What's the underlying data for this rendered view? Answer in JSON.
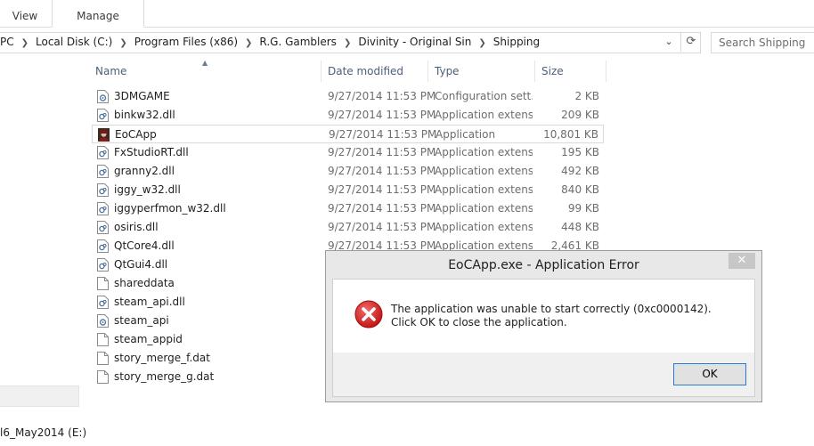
{
  "ribbon": {
    "tabs": [
      {
        "label": "View"
      },
      {
        "label": "Manage"
      }
    ]
  },
  "address": {
    "crumbs": [
      "PC",
      "Local Disk (C:)",
      "Program Files (x86)",
      "R.G. Gamblers",
      "Divinity - Original Sin",
      "Shipping"
    ],
    "search_placeholder": "Search Shipping"
  },
  "nav": {
    "drive_label": "l6_May2014 (E:)"
  },
  "columns": {
    "name": "Name",
    "date": "Date modified",
    "type": "Type",
    "size": "Size"
  },
  "files": [
    {
      "name": "3DMGAME",
      "date": "9/27/2014 11:53 PM",
      "type": "Configuration sett...",
      "size": "2 KB",
      "icon": "config-file-icon"
    },
    {
      "name": "binkw32.dll",
      "date": "9/27/2014 11:53 PM",
      "type": "Application extens...",
      "size": "209 KB",
      "icon": "dll-file-icon"
    },
    {
      "name": "EoCApp",
      "date": "9/27/2014 11:53 PM",
      "type": "Application",
      "size": "10,801 KB",
      "icon": "app-icon"
    },
    {
      "name": "FxStudioRT.dll",
      "date": "9/27/2014 11:53 PM",
      "type": "Application extens...",
      "size": "195 KB",
      "icon": "dll-file-icon"
    },
    {
      "name": "granny2.dll",
      "date": "9/27/2014 11:53 PM",
      "type": "Application extens...",
      "size": "492 KB",
      "icon": "dll-file-icon"
    },
    {
      "name": "iggy_w32.dll",
      "date": "9/27/2014 11:53 PM",
      "type": "Application extens...",
      "size": "840 KB",
      "icon": "dll-file-icon"
    },
    {
      "name": "iggyperfmon_w32.dll",
      "date": "9/27/2014 11:53 PM",
      "type": "Application extens...",
      "size": "99 KB",
      "icon": "dll-file-icon"
    },
    {
      "name": "osiris.dll",
      "date": "9/27/2014 11:53 PM",
      "type": "Application extens...",
      "size": "448 KB",
      "icon": "dll-file-icon"
    },
    {
      "name": "QtCore4.dll",
      "date": "9/27/2014 11:53 PM",
      "type": "Application extens...",
      "size": "2,461 KB",
      "icon": "dll-file-icon"
    },
    {
      "name": "QtGui4.dll",
      "date": "",
      "type": "",
      "size": "",
      "icon": "dll-file-icon"
    },
    {
      "name": "shareddata",
      "date": "",
      "type": "",
      "size": "",
      "icon": "file-icon"
    },
    {
      "name": "steam_api.dll",
      "date": "",
      "type": "",
      "size": "",
      "icon": "dll-file-icon"
    },
    {
      "name": "steam_api",
      "date": "",
      "type": "",
      "size": "",
      "icon": "config-file-icon"
    },
    {
      "name": "steam_appid",
      "date": "",
      "type": "",
      "size": "",
      "icon": "file-icon"
    },
    {
      "name": "story_merge_f.dat",
      "date": "",
      "type": "",
      "size": "",
      "icon": "file-icon"
    },
    {
      "name": "story_merge_g.dat",
      "date": "",
      "type": "",
      "size": "",
      "icon": "file-icon"
    }
  ],
  "dialog": {
    "title": "EoCApp.exe - Application Error",
    "close_glyph": "✕",
    "message": "The application was unable to start correctly (0xc0000142). Click OK to close the application.",
    "ok_label": "OK"
  }
}
